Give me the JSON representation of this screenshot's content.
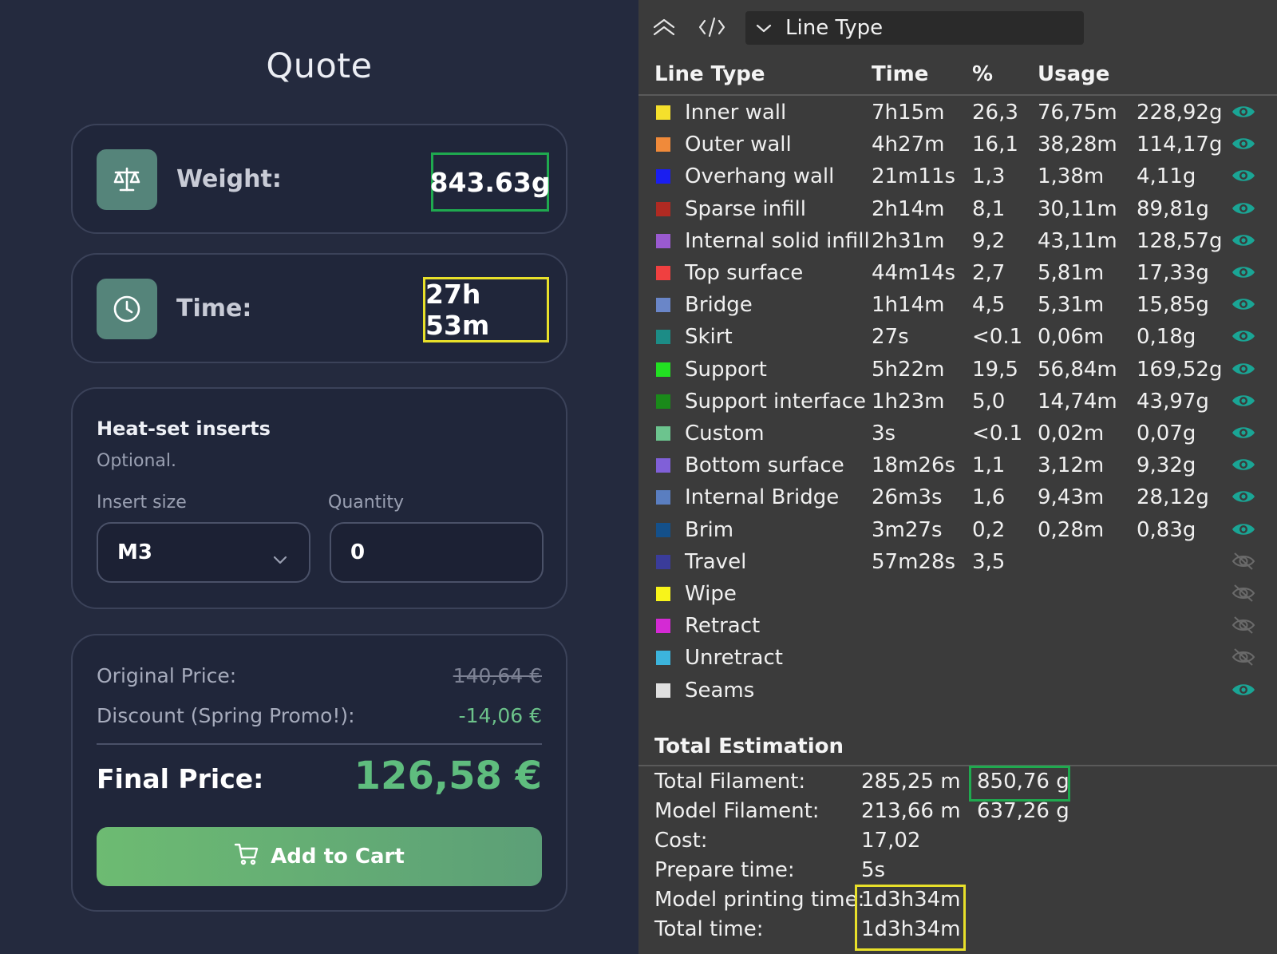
{
  "quote": {
    "title": "Quote",
    "weight": {
      "label": "Weight:",
      "value": "843.63g",
      "icon": "scale-icon"
    },
    "time": {
      "label": "Time:",
      "value": "27h 53m",
      "icon": "clock-icon"
    },
    "inserts": {
      "title": "Heat-set inserts",
      "subtitle": "Optional.",
      "size_label": "Insert size",
      "size_value": "M3",
      "quantity_label": "Quantity",
      "quantity_value": "0"
    },
    "pricing": {
      "original_label": "Original Price:",
      "original_value": "140,64 €",
      "discount_label": "Discount (Spring Promo!):",
      "discount_value": "-14,06 €",
      "final_label": "Final Price:",
      "final_value": "126,58 €",
      "cart_button": "Add to Cart",
      "cart_icon": "cart-icon"
    },
    "colors": {
      "background": "#242a3e",
      "accent_green": "#5fbd7e",
      "weight_highlight": "#1fa94f",
      "time_highlight": "#e8e02a"
    }
  },
  "slicer": {
    "view_selector": "Line Type",
    "headers": {
      "line_type": "Line Type",
      "time": "Time",
      "percent": "%",
      "usage": "Usage"
    },
    "rows": [
      {
        "name": "Inner wall",
        "color": "#f5e02c",
        "time": "7h15m",
        "pct": "26,3",
        "length": "76,75m",
        "weight": "228,92g",
        "visible": true
      },
      {
        "name": "Outer wall",
        "color": "#f08a3a",
        "time": "4h27m",
        "pct": "16,1",
        "length": "38,28m",
        "weight": "114,17g",
        "visible": true
      },
      {
        "name": "Overhang wall",
        "color": "#1a1ef0",
        "time": "21m11s",
        "pct": "1,3",
        "length": "1,38m",
        "weight": "4,11g",
        "visible": true
      },
      {
        "name": "Sparse infill",
        "color": "#b02a22",
        "time": "2h14m",
        "pct": "8,1",
        "length": "30,11m",
        "weight": "89,81g",
        "visible": true
      },
      {
        "name": "Internal solid infill",
        "color": "#9a5ad0",
        "time": "2h31m",
        "pct": "9,2",
        "length": "43,11m",
        "weight": "128,57g",
        "visible": true
      },
      {
        "name": "Top surface",
        "color": "#f04040",
        "time": "44m14s",
        "pct": "2,7",
        "length": "5,81m",
        "weight": "17,33g",
        "visible": true
      },
      {
        "name": "Bridge",
        "color": "#6a86c8",
        "time": "1h14m",
        "pct": "4,5",
        "length": "5,31m",
        "weight": "15,85g",
        "visible": true
      },
      {
        "name": "Skirt",
        "color": "#1c8c86",
        "time": "27s",
        "pct": "<0.1",
        "length": "0,06m",
        "weight": "0,18g",
        "visible": true
      },
      {
        "name": "Support",
        "color": "#22e022",
        "time": "5h22m",
        "pct": "19,5",
        "length": "56,84m",
        "weight": "169,52g",
        "visible": true
      },
      {
        "name": "Support interface",
        "color": "#1a8a1a",
        "time": "1h23m",
        "pct": "5,0",
        "length": "14,74m",
        "weight": "43,97g",
        "visible": true
      },
      {
        "name": "Custom",
        "color": "#6cc48e",
        "time": "3s",
        "pct": "<0.1",
        "length": "0,02m",
        "weight": "0,07g",
        "visible": true
      },
      {
        "name": "Bottom surface",
        "color": "#8060d8",
        "time": "18m26s",
        "pct": "1,1",
        "length": "3,12m",
        "weight": "9,32g",
        "visible": true
      },
      {
        "name": "Internal Bridge",
        "color": "#5a7ec0",
        "time": "26m3s",
        "pct": "1,6",
        "length": "9,43m",
        "weight": "28,12g",
        "visible": true
      },
      {
        "name": "Brim",
        "color": "#14508a",
        "time": "3m27s",
        "pct": "0,2",
        "length": "0,28m",
        "weight": "0,83g",
        "visible": true
      },
      {
        "name": "Travel",
        "color": "#3a3c9a",
        "time": "57m28s",
        "pct": "3,5",
        "length": "",
        "weight": "",
        "visible": false
      },
      {
        "name": "Wipe",
        "color": "#f8f41a",
        "time": "",
        "pct": "",
        "length": "",
        "weight": "",
        "visible": false
      },
      {
        "name": "Retract",
        "color": "#d42ad4",
        "time": "",
        "pct": "",
        "length": "",
        "weight": "",
        "visible": false
      },
      {
        "name": "Unretract",
        "color": "#3cb4dc",
        "time": "",
        "pct": "",
        "length": "",
        "weight": "",
        "visible": false
      },
      {
        "name": "Seams",
        "color": "#e0e0e0",
        "time": "",
        "pct": "",
        "length": "",
        "weight": "",
        "visible": true
      }
    ],
    "total": {
      "title": "Total Estimation",
      "rows": [
        {
          "label": "Total Filament:",
          "value": "285,25 m",
          "weight": "850,76 g"
        },
        {
          "label": "Model Filament:",
          "value": "213,66 m",
          "weight": "637,26 g"
        },
        {
          "label": "Cost:",
          "value": "17,02",
          "weight": ""
        },
        {
          "label": "Prepare time:",
          "value": "5s",
          "weight": ""
        },
        {
          "label": "Model printing time:",
          "value": "1d3h34m",
          "weight": ""
        },
        {
          "label": "Total time:",
          "value": "1d3h34m",
          "weight": ""
        }
      ]
    },
    "colors": {
      "background": "#3b3b3b",
      "eye_visible": "#1aa595",
      "eye_hidden": "#6a6a6a"
    }
  }
}
